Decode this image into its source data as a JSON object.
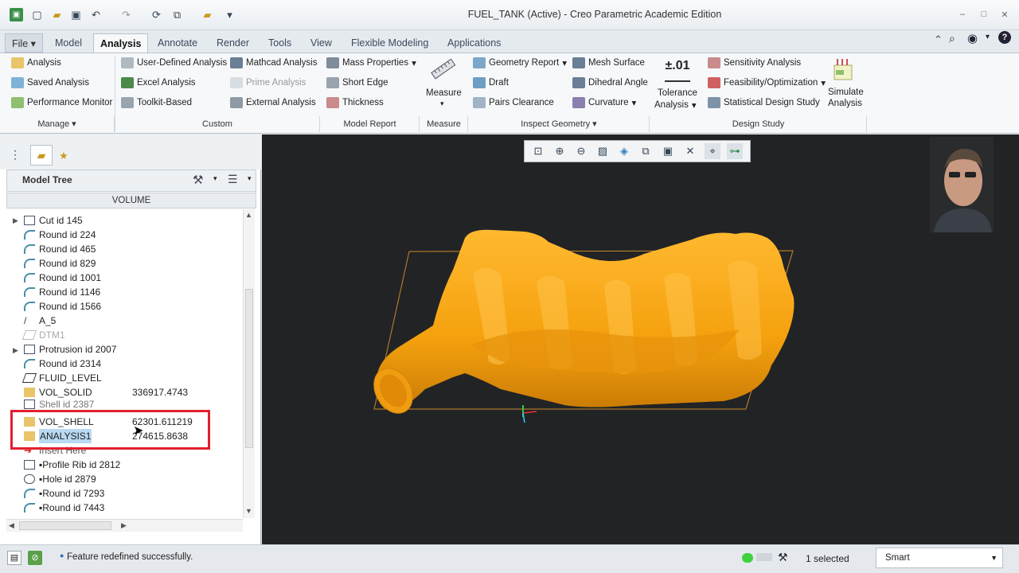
{
  "window": {
    "title": "FUEL_TANK (Active) - Creo Parametric Academic Edition"
  },
  "tabs": [
    {
      "label": "File"
    },
    {
      "label": "Model"
    },
    {
      "label": "Analysis"
    },
    {
      "label": "Annotate"
    },
    {
      "label": "Render"
    },
    {
      "label": "Tools"
    },
    {
      "label": "View"
    },
    {
      "label": "Flexible Modeling"
    },
    {
      "label": "Applications"
    }
  ],
  "ribbon": {
    "manage": {
      "analysis": "Analysis",
      "saved_analysis": "Saved Analysis",
      "performance_monitor": "Performance Monitor",
      "group": "Manage"
    },
    "custom": {
      "user_defined": "User-Defined Analysis",
      "excel": "Excel Analysis",
      "toolkit": "Toolkit-Based",
      "mathcad": "Mathcad Analysis",
      "prime": "Prime Analysis",
      "external": "External Analysis",
      "group": "Custom"
    },
    "model_report": {
      "mass_properties": "Mass Properties",
      "short_edge": "Short Edge",
      "thickness": "Thickness",
      "group": "Model Report"
    },
    "measure": {
      "label": "Measure",
      "group": "Measure"
    },
    "inspect": {
      "geometry_report": "Geometry Report",
      "draft": "Draft",
      "pairs_clearance": "Pairs Clearance",
      "mesh_surface": "Mesh Surface",
      "dihedral_angle": "Dihedral Angle",
      "curvature": "Curvature",
      "group": "Inspect Geometry"
    },
    "tolerance": {
      "icon_text": "±.01",
      "line1": "Tolerance",
      "line2": "Analysis"
    },
    "design_study": {
      "sensitivity": "Sensitivity Analysis",
      "feasibility": "Feasibility/Optimization",
      "statistical": "Statistical Design Study",
      "simulate1": "Simulate",
      "simulate2": "Analysis",
      "group": "Design Study"
    }
  },
  "model_tree": {
    "title": "Model Tree",
    "column": "VOLUME",
    "rows": [
      {
        "label": "Cut id 145",
        "value": ""
      },
      {
        "label": "Round id 224",
        "value": ""
      },
      {
        "label": "Round id 465",
        "value": ""
      },
      {
        "label": "Round id 829",
        "value": ""
      },
      {
        "label": "Round id 1001",
        "value": ""
      },
      {
        "label": "Round id 1146",
        "value": ""
      },
      {
        "label": "Round id 1566",
        "value": ""
      },
      {
        "label": "A_5",
        "value": ""
      },
      {
        "label": "DTM1",
        "value": ""
      },
      {
        "label": "Protrusion id 2007",
        "value": ""
      },
      {
        "label": "Round id 2314",
        "value": ""
      },
      {
        "label": "FLUID_LEVEL",
        "value": ""
      },
      {
        "label": "VOL_SOLID",
        "value": "336917.4743"
      },
      {
        "label": "Shell id 2387",
        "value": ""
      },
      {
        "label": "VOL_SHELL",
        "value": "62301.611219"
      },
      {
        "label": "ANALYSIS1",
        "value": "274615.8638"
      },
      {
        "label": "Insert Here",
        "value": ""
      },
      {
        "label": "Profile Rib id 2812",
        "value": ""
      },
      {
        "label": "Hole id 2879",
        "value": ""
      },
      {
        "label": "Round id 7293",
        "value": ""
      },
      {
        "label": "Round id 7443",
        "value": ""
      }
    ]
  },
  "status": {
    "message": "Feature redefined successfully.",
    "selected": "1 selected",
    "filter": "Smart"
  },
  "colors": {
    "part": "#f5a623",
    "highlight": "#e2202f",
    "viewport_bg": "#222325"
  }
}
